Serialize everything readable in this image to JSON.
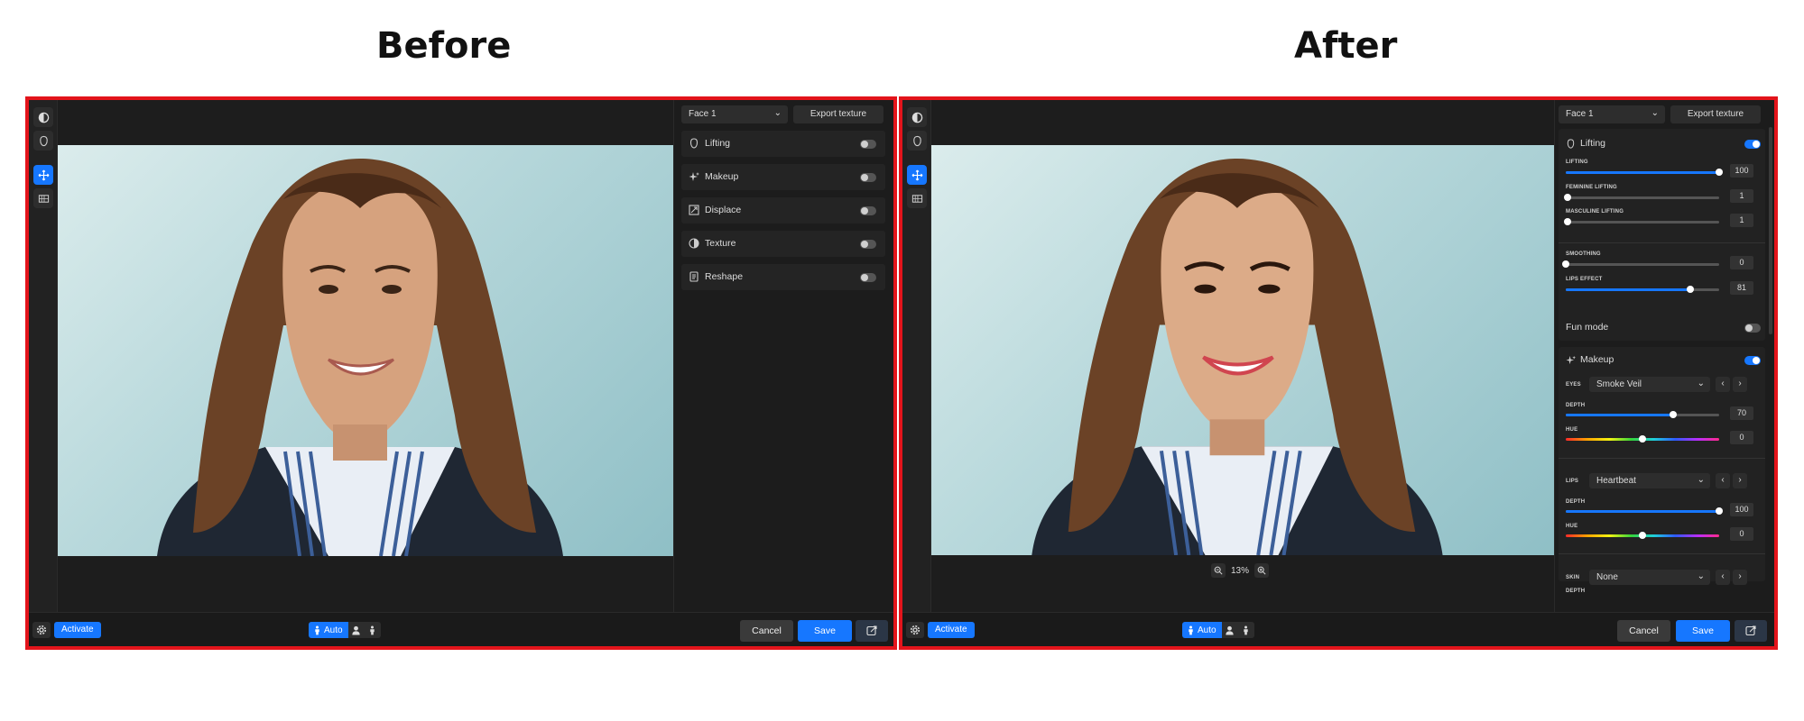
{
  "captions": {
    "before": "Before",
    "after": "After"
  },
  "before": {
    "face_select": "Face 1",
    "export_texture": "Export texture",
    "sections": [
      {
        "label": "Lifting",
        "icon": "face-outline-icon",
        "on": false
      },
      {
        "label": "Makeup",
        "icon": "sparkle-icon",
        "on": false
      },
      {
        "label": "Displace",
        "icon": "displace-icon",
        "on": false
      },
      {
        "label": "Texture",
        "icon": "half-circle-icon",
        "on": false
      },
      {
        "label": "Reshape",
        "icon": "reshape-icon",
        "on": false
      }
    ],
    "bottom": {
      "activate": "Activate",
      "auto": "Auto",
      "cancel": "Cancel",
      "save": "Save"
    }
  },
  "after": {
    "face_select": "Face 1",
    "export_texture": "Export texture",
    "lifting": {
      "title": "Lifting",
      "on": true,
      "sliders": [
        {
          "label": "LIFTING",
          "value": "100",
          "fraction": 1.0
        },
        {
          "label": "FEMININE LIFTING",
          "value": "1",
          "fraction": 0.01
        },
        {
          "label": "MASCULINE LIFTING",
          "value": "1",
          "fraction": 0.01
        },
        {
          "label": "SMOOTHING",
          "value": "0",
          "fraction": 0.0
        },
        {
          "label": "LIPS EFFECT",
          "value": "81",
          "fraction": 0.81
        }
      ]
    },
    "fun_mode": {
      "label": "Fun mode",
      "on": false
    },
    "makeup": {
      "title": "Makeup",
      "on": true,
      "eyes": {
        "label": "EYES",
        "preset": "Smoke Veil",
        "depth_label": "DEPTH",
        "depth": "70",
        "depth_fraction": 0.7,
        "hue_label": "HUE",
        "hue": "0",
        "hue_fraction": 0.5
      },
      "lips": {
        "label": "LIPS",
        "preset": "Heartbeat",
        "depth_label": "DEPTH",
        "depth": "100",
        "depth_fraction": 1.0,
        "hue_label": "HUE",
        "hue": "0",
        "hue_fraction": 0.5
      },
      "skin": {
        "label": "SKIN",
        "preset": "None",
        "depth_label": "DEPTH"
      }
    },
    "zoom": "13%",
    "bottom": {
      "activate": "Activate",
      "auto": "Auto",
      "cancel": "Cancel",
      "save": "Save"
    }
  },
  "colors": {
    "accent": "#1677ff",
    "frame": "#e3141b",
    "panel": "#1c1c1c"
  }
}
